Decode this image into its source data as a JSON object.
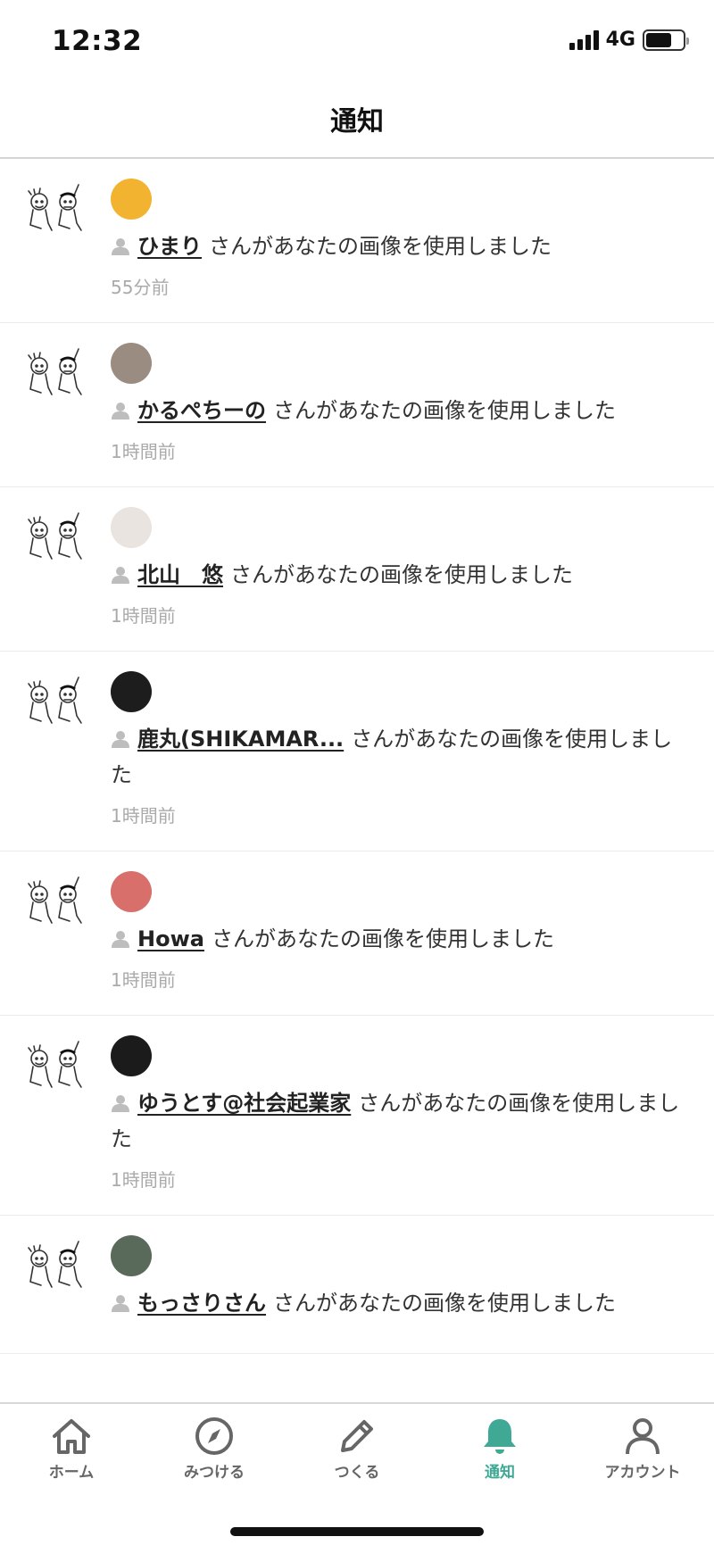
{
  "status_bar": {
    "time": "12:32",
    "network": "4G",
    "battery_level": 0.7
  },
  "header": {
    "title": "通知"
  },
  "notifications": [
    {
      "user": "ひまり",
      "message": "さんがあなたの画像を使用しました",
      "time": "55分前",
      "avatar_color": "#f2b430"
    },
    {
      "user": "かるぺちーの",
      "message": "さんがあなたの画像を使用しました",
      "time": "1時間前",
      "avatar_color": "#9a8c80"
    },
    {
      "user": "北山　悠",
      "message": "さんがあなたの画像を使用しました",
      "time": "1時間前",
      "avatar_color": "#e9e4df"
    },
    {
      "user": "鹿丸(SHIKAMAR...",
      "message": "さんがあなたの画像を使用しました",
      "time": "1時間前",
      "avatar_color": "#1d1d1d"
    },
    {
      "user": "Howa",
      "message": "さんがあなたの画像を使用しました",
      "time": "1時間前",
      "avatar_color": "#d86f6a"
    },
    {
      "user": "ゆうとす@社会起業家",
      "message": "さんがあなたの画像を使用しました",
      "time": "1時間前",
      "avatar_color": "#1b1b1b"
    },
    {
      "user": "もっさりさん",
      "message": "さんがあなたの画像を使用しました",
      "time": "",
      "avatar_color": "#5a6a5a"
    }
  ],
  "tabbar": {
    "items": [
      {
        "label": "ホーム",
        "icon": "home-icon"
      },
      {
        "label": "みつける",
        "icon": "compass-icon"
      },
      {
        "label": "つくる",
        "icon": "pencil-icon"
      },
      {
        "label": "通知",
        "icon": "bell-icon",
        "active": true
      },
      {
        "label": "アカウント",
        "icon": "person-icon"
      }
    ],
    "active_color": "#3fa995"
  }
}
